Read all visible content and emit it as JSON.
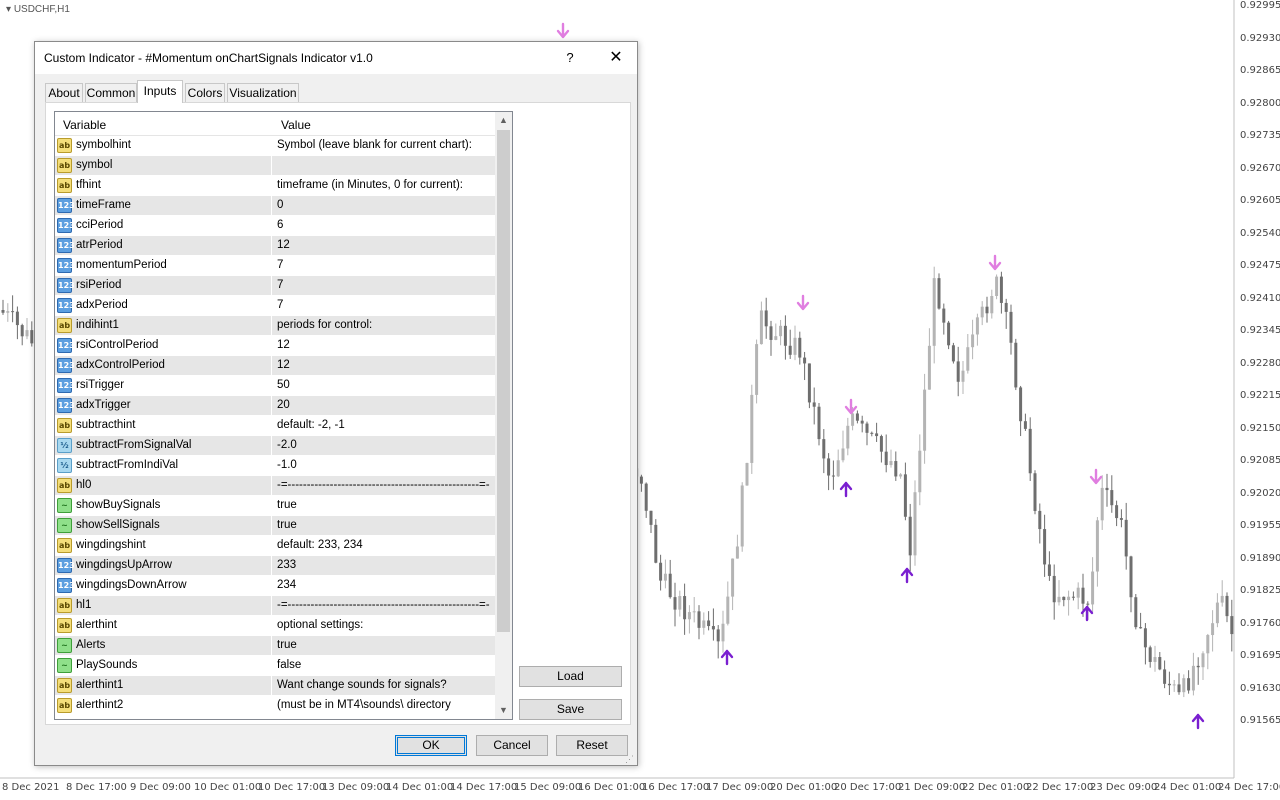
{
  "chart": {
    "symbol": "USDCHF,H1",
    "price_labels": [
      "0.92995",
      "0.92930",
      "0.92865",
      "0.92800",
      "0.92735",
      "0.92670",
      "0.92605",
      "0.92540",
      "0.92475",
      "0.92410",
      "0.92345",
      "0.92280",
      "0.92215",
      "0.92150",
      "0.92085",
      "0.92020",
      "0.91955",
      "0.91890",
      "0.91825",
      "0.91760",
      "0.91695",
      "0.91630",
      "0.91565"
    ],
    "time_labels": [
      "8 Dec 2021",
      "8 Dec 17:00",
      "9 Dec 09:00",
      "10 Dec 01:00",
      "10 Dec 17:00",
      "13 Dec 09:00",
      "14 Dec 01:00",
      "14 Dec 17:00",
      "15 Dec 09:00",
      "16 Dec 01:00",
      "16 Dec 17:00",
      "17 Dec 09:00",
      "20 Dec 01:00",
      "20 Dec 17:00",
      "21 Dec 09:00",
      "22 Dec 01:00",
      "22 Dec 17:00",
      "23 Dec 09:00",
      "24 Dec 01:00",
      "24 Dec 17:00"
    ],
    "colors": {
      "candle_up": "#b4b4b4",
      "candle_down": "#6e6e6e",
      "sell_arrow": "#e07ee0",
      "buy_arrow": "#7a1fd0",
      "axis_text": "#444444"
    }
  },
  "dialog": {
    "title": "Custom Indicator - #Momentum onChartSignals Indicator v1.0",
    "help": "?",
    "close_icon": "close-icon",
    "tabs": [
      {
        "label": "About",
        "active": false
      },
      {
        "label": "Common",
        "active": false
      },
      {
        "label": "Inputs",
        "active": true
      },
      {
        "label": "Colors",
        "active": false
      },
      {
        "label": "Visualization",
        "active": false
      }
    ],
    "grid": {
      "col_variable": "Variable",
      "col_value": "Value",
      "rows": [
        {
          "type": "string",
          "icon": "ab",
          "name": "symbolhint",
          "value": "Symbol (leave blank for current chart):"
        },
        {
          "type": "string",
          "icon": "ab",
          "name": "symbol",
          "value": ""
        },
        {
          "type": "string",
          "icon": "ab",
          "name": "tfhint",
          "value": "timeframe (in Minutes, 0 for current):"
        },
        {
          "type": "int",
          "icon": "123",
          "name": "timeFrame",
          "value": "0"
        },
        {
          "type": "int",
          "icon": "123",
          "name": "cciPeriod",
          "value": "6"
        },
        {
          "type": "int",
          "icon": "123",
          "name": "atrPeriod",
          "value": "12"
        },
        {
          "type": "int",
          "icon": "123",
          "name": "momentumPeriod",
          "value": "7"
        },
        {
          "type": "int",
          "icon": "123",
          "name": "rsiPeriod",
          "value": "7"
        },
        {
          "type": "int",
          "icon": "123",
          "name": "adxPeriod",
          "value": "7"
        },
        {
          "type": "string",
          "icon": "ab",
          "name": "indihint1",
          "value": "periods for control:"
        },
        {
          "type": "int",
          "icon": "123",
          "name": "rsiControlPeriod",
          "value": "12"
        },
        {
          "type": "int",
          "icon": "123",
          "name": "adxControlPeriod",
          "value": "12"
        },
        {
          "type": "int",
          "icon": "123",
          "name": "rsiTrigger",
          "value": "50"
        },
        {
          "type": "int",
          "icon": "123",
          "name": "adxTrigger",
          "value": "20"
        },
        {
          "type": "string",
          "icon": "ab",
          "name": "subtracthint",
          "value": "default: -2, -1"
        },
        {
          "type": "double",
          "icon": "½",
          "name": "subtractFromSignalVal",
          "value": "-2.0"
        },
        {
          "type": "double",
          "icon": "½",
          "name": "subtractFromIndiVal",
          "value": "-1.0"
        },
        {
          "type": "string",
          "icon": "ab",
          "name": "hl0",
          "value": "-=--------------------------------------------------=-"
        },
        {
          "type": "bool",
          "icon": "~",
          "name": "showBuySignals",
          "value": "true"
        },
        {
          "type": "bool",
          "icon": "~",
          "name": "showSellSignals",
          "value": "true"
        },
        {
          "type": "string",
          "icon": "ab",
          "name": "wingdingshint",
          "value": "default: 233, 234"
        },
        {
          "type": "int",
          "icon": "123",
          "name": "wingdingsUpArrow",
          "value": "233"
        },
        {
          "type": "int",
          "icon": "123",
          "name": "wingdingsDownArrow",
          "value": "234"
        },
        {
          "type": "string",
          "icon": "ab",
          "name": "hl1",
          "value": "-=--------------------------------------------------=-"
        },
        {
          "type": "string",
          "icon": "ab",
          "name": "alerthint",
          "value": "optional settings:"
        },
        {
          "type": "bool",
          "icon": "~",
          "name": "Alerts",
          "value": "true"
        },
        {
          "type": "bool",
          "icon": "~",
          "name": "PlaySounds",
          "value": "false"
        },
        {
          "type": "string",
          "icon": "ab",
          "name": "alerthint1",
          "value": "Want change sounds for signals?"
        },
        {
          "type": "string",
          "icon": "ab",
          "name": "alerthint2",
          "value": "(must be in MT4\\sounds\\ directory"
        }
      ]
    },
    "buttons": {
      "load": "Load",
      "save": "Save",
      "ok": "OK",
      "cancel": "Cancel",
      "reset": "Reset"
    }
  }
}
